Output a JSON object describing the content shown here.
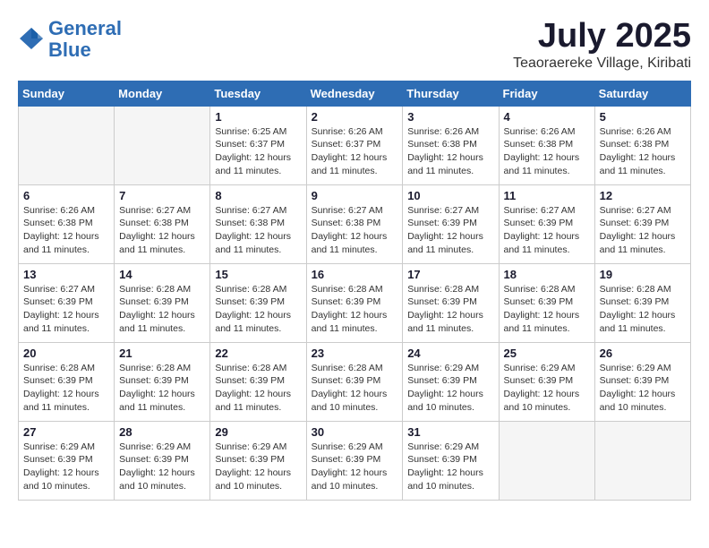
{
  "header": {
    "logo_line1": "General",
    "logo_line2": "Blue",
    "month": "July 2025",
    "location": "Teaoraereke Village, Kiribati"
  },
  "weekdays": [
    "Sunday",
    "Monday",
    "Tuesday",
    "Wednesday",
    "Thursday",
    "Friday",
    "Saturday"
  ],
  "weeks": [
    [
      {
        "day": "",
        "info": ""
      },
      {
        "day": "",
        "info": ""
      },
      {
        "day": "1",
        "info": "Sunrise: 6:25 AM\nSunset: 6:37 PM\nDaylight: 12 hours\nand 11 minutes."
      },
      {
        "day": "2",
        "info": "Sunrise: 6:26 AM\nSunset: 6:37 PM\nDaylight: 12 hours\nand 11 minutes."
      },
      {
        "day": "3",
        "info": "Sunrise: 6:26 AM\nSunset: 6:38 PM\nDaylight: 12 hours\nand 11 minutes."
      },
      {
        "day": "4",
        "info": "Sunrise: 6:26 AM\nSunset: 6:38 PM\nDaylight: 12 hours\nand 11 minutes."
      },
      {
        "day": "5",
        "info": "Sunrise: 6:26 AM\nSunset: 6:38 PM\nDaylight: 12 hours\nand 11 minutes."
      }
    ],
    [
      {
        "day": "6",
        "info": "Sunrise: 6:26 AM\nSunset: 6:38 PM\nDaylight: 12 hours\nand 11 minutes."
      },
      {
        "day": "7",
        "info": "Sunrise: 6:27 AM\nSunset: 6:38 PM\nDaylight: 12 hours\nand 11 minutes."
      },
      {
        "day": "8",
        "info": "Sunrise: 6:27 AM\nSunset: 6:38 PM\nDaylight: 12 hours\nand 11 minutes."
      },
      {
        "day": "9",
        "info": "Sunrise: 6:27 AM\nSunset: 6:38 PM\nDaylight: 12 hours\nand 11 minutes."
      },
      {
        "day": "10",
        "info": "Sunrise: 6:27 AM\nSunset: 6:39 PM\nDaylight: 12 hours\nand 11 minutes."
      },
      {
        "day": "11",
        "info": "Sunrise: 6:27 AM\nSunset: 6:39 PM\nDaylight: 12 hours\nand 11 minutes."
      },
      {
        "day": "12",
        "info": "Sunrise: 6:27 AM\nSunset: 6:39 PM\nDaylight: 12 hours\nand 11 minutes."
      }
    ],
    [
      {
        "day": "13",
        "info": "Sunrise: 6:27 AM\nSunset: 6:39 PM\nDaylight: 12 hours\nand 11 minutes."
      },
      {
        "day": "14",
        "info": "Sunrise: 6:28 AM\nSunset: 6:39 PM\nDaylight: 12 hours\nand 11 minutes."
      },
      {
        "day": "15",
        "info": "Sunrise: 6:28 AM\nSunset: 6:39 PM\nDaylight: 12 hours\nand 11 minutes."
      },
      {
        "day": "16",
        "info": "Sunrise: 6:28 AM\nSunset: 6:39 PM\nDaylight: 12 hours\nand 11 minutes."
      },
      {
        "day": "17",
        "info": "Sunrise: 6:28 AM\nSunset: 6:39 PM\nDaylight: 12 hours\nand 11 minutes."
      },
      {
        "day": "18",
        "info": "Sunrise: 6:28 AM\nSunset: 6:39 PM\nDaylight: 12 hours\nand 11 minutes."
      },
      {
        "day": "19",
        "info": "Sunrise: 6:28 AM\nSunset: 6:39 PM\nDaylight: 12 hours\nand 11 minutes."
      }
    ],
    [
      {
        "day": "20",
        "info": "Sunrise: 6:28 AM\nSunset: 6:39 PM\nDaylight: 12 hours\nand 11 minutes."
      },
      {
        "day": "21",
        "info": "Sunrise: 6:28 AM\nSunset: 6:39 PM\nDaylight: 12 hours\nand 11 minutes."
      },
      {
        "day": "22",
        "info": "Sunrise: 6:28 AM\nSunset: 6:39 PM\nDaylight: 12 hours\nand 11 minutes."
      },
      {
        "day": "23",
        "info": "Sunrise: 6:28 AM\nSunset: 6:39 PM\nDaylight: 12 hours\nand 10 minutes."
      },
      {
        "day": "24",
        "info": "Sunrise: 6:29 AM\nSunset: 6:39 PM\nDaylight: 12 hours\nand 10 minutes."
      },
      {
        "day": "25",
        "info": "Sunrise: 6:29 AM\nSunset: 6:39 PM\nDaylight: 12 hours\nand 10 minutes."
      },
      {
        "day": "26",
        "info": "Sunrise: 6:29 AM\nSunset: 6:39 PM\nDaylight: 12 hours\nand 10 minutes."
      }
    ],
    [
      {
        "day": "27",
        "info": "Sunrise: 6:29 AM\nSunset: 6:39 PM\nDaylight: 12 hours\nand 10 minutes."
      },
      {
        "day": "28",
        "info": "Sunrise: 6:29 AM\nSunset: 6:39 PM\nDaylight: 12 hours\nand 10 minutes."
      },
      {
        "day": "29",
        "info": "Sunrise: 6:29 AM\nSunset: 6:39 PM\nDaylight: 12 hours\nand 10 minutes."
      },
      {
        "day": "30",
        "info": "Sunrise: 6:29 AM\nSunset: 6:39 PM\nDaylight: 12 hours\nand 10 minutes."
      },
      {
        "day": "31",
        "info": "Sunrise: 6:29 AM\nSunset: 6:39 PM\nDaylight: 12 hours\nand 10 minutes."
      },
      {
        "day": "",
        "info": ""
      },
      {
        "day": "",
        "info": ""
      }
    ]
  ]
}
